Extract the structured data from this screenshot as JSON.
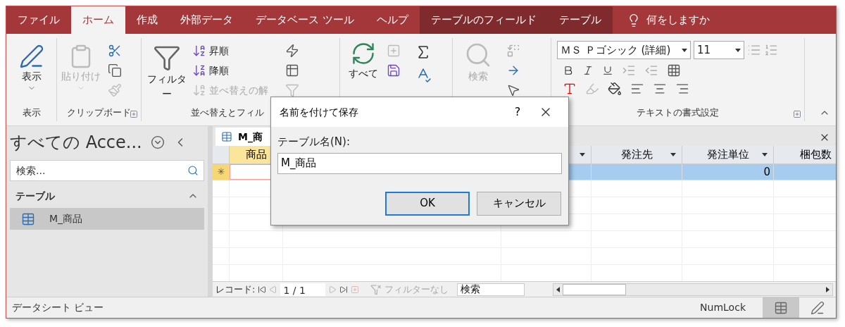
{
  "tabs": [
    {
      "label": "ファイル",
      "selected": false,
      "kind": "normal"
    },
    {
      "label": "ホーム",
      "selected": true,
      "kind": "normal"
    },
    {
      "label": "作成",
      "selected": false,
      "kind": "normal"
    },
    {
      "label": "外部データ",
      "selected": false,
      "kind": "normal"
    },
    {
      "label": "データベース ツール",
      "selected": false,
      "kind": "normal"
    },
    {
      "label": "ヘルプ",
      "selected": false,
      "kind": "normal"
    },
    {
      "label": "テーブルのフィールド",
      "selected": false,
      "kind": "context"
    },
    {
      "label": "テーブル",
      "selected": false,
      "kind": "context"
    }
  ],
  "tell_me": "何をしますか",
  "ribbon": {
    "view": {
      "button": "表示",
      "label": "表示"
    },
    "clipboard": {
      "paste": "貼り付け",
      "label": "クリップボード"
    },
    "sort_filter": {
      "filter": "フィルター",
      "ascending": "昇順",
      "descending": "降順",
      "clear_sort": "並べ替えの解",
      "label": "並べ替えとフィル"
    },
    "records": {
      "refresh": "すべて"
    },
    "find": {
      "find": "検索"
    },
    "text_format": {
      "font": "ＭＳ Ｐゴシック (詳細)",
      "size": "11",
      "label": "テキストの書式設定"
    }
  },
  "nav_pane": {
    "title": "すべての Acce...",
    "search_placeholder": "検索...",
    "section": {
      "label": "テーブル",
      "expanded": true
    },
    "items": [
      {
        "label": "M_商品",
        "selected": true
      }
    ]
  },
  "document": {
    "tab": "M_商",
    "columns": [
      {
        "label": "商品"
      },
      {
        "label": "発注先"
      },
      {
        "label": "発注単位",
        "new_row_value": "0"
      },
      {
        "label": "梱包数"
      }
    ],
    "new_row_marker": "✳",
    "record_nav": {
      "label": "レコード:",
      "position": "1 / 1",
      "filter": "フィルターなし",
      "search_placeholder": "検索"
    }
  },
  "dialog": {
    "title": "名前を付けて保存",
    "help": "?",
    "field_label": "テーブル名(N):",
    "value": "M_商品",
    "buttons": [
      {
        "label": "OK",
        "default": true
      },
      {
        "label": "キャンセル",
        "default": false
      }
    ]
  },
  "status_bar": {
    "text": "データシート ビュー",
    "indicator": "NumLock",
    "views": [
      {
        "selected": true
      },
      {
        "selected": false
      }
    ]
  }
}
